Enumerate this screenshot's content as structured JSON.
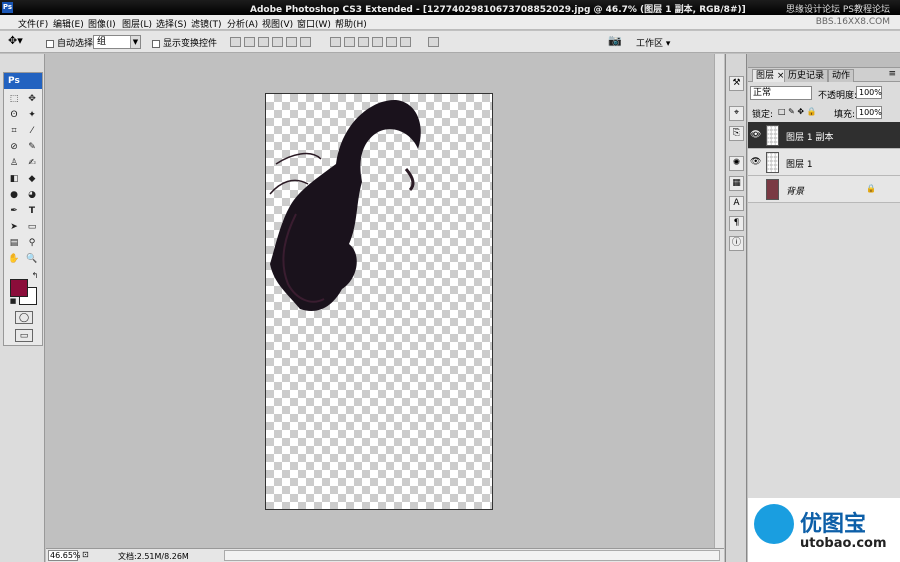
{
  "titlebar": {
    "title": "Adobe Photoshop CS3 Extended - [12774029810673708852029.jpg @ 46.7% (图层 1 副本, RGB/8#)]",
    "watermark": "思缘设计论坛   PS教程论坛"
  },
  "menu": {
    "items": [
      "文件(F)",
      "编辑(E)",
      "图像(I)",
      "图层(L)",
      "选择(S)",
      "滤镜(T)",
      "分析(A)",
      "视图(V)",
      "窗口(W)",
      "帮助(H)"
    ],
    "watermark2": "BBS.16XX8.COM"
  },
  "options": {
    "auto_select_label": "自动选择:",
    "auto_select_value": "组",
    "show_transform_label": "显示变换控件",
    "workspace_label": "工作区 ▾"
  },
  "toolbox": {
    "header": "Ps"
  },
  "status": {
    "zoom": "46.65%",
    "doc_size": "文档:2.51M/8.26M"
  },
  "layers_panel": {
    "tabs": [
      "图层 ×",
      "历史记录",
      "动作"
    ],
    "blend_mode": "正常",
    "opacity_label": "不透明度:",
    "opacity_value": "100%",
    "lock_label": "锁定:",
    "fill_label": "填充:",
    "fill_value": "100%",
    "layers": [
      {
        "name": "图层 1 副本",
        "selected": true,
        "visible": true
      },
      {
        "name": "图层 1",
        "selected": false,
        "visible": true
      },
      {
        "name": "背景",
        "selected": false,
        "visible": false,
        "locked": true
      }
    ]
  },
  "brand": {
    "cn": "优图宝",
    "en": "utobao.com"
  },
  "colors": {
    "foreground": "#8b0d3a",
    "background": "#ffffff"
  }
}
